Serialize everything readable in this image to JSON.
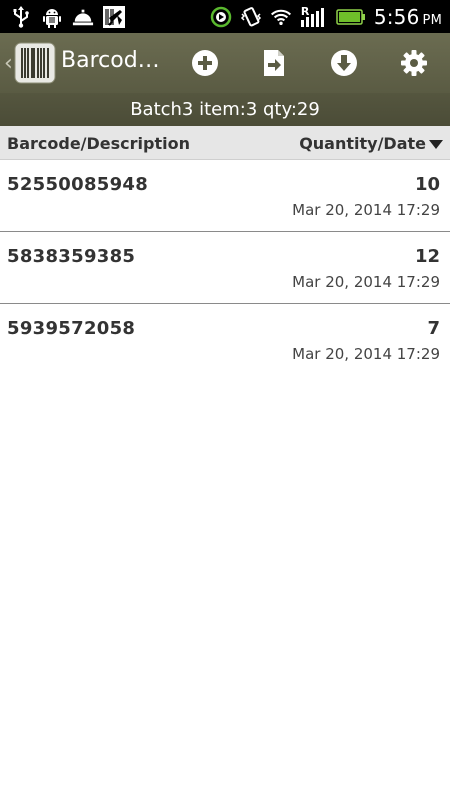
{
  "status_bar": {
    "icons": [
      "usb-icon",
      "android-debug-icon",
      "service-bell-icon",
      "barcode-app-icon",
      "sync-icon",
      "vibrate-icon",
      "wifi-icon",
      "signal-icon",
      "battery-icon"
    ],
    "roaming_letter": "R",
    "time": "5:56",
    "ampm": "PM"
  },
  "action_bar": {
    "title": "Barcod…",
    "buttons": [
      "add-icon",
      "export-icon",
      "download-icon",
      "settings-icon"
    ]
  },
  "batch_info": "Batch3 item:3 qty:29",
  "columns": {
    "left": "Barcode/Description",
    "right": "Quantity/Date"
  },
  "items": [
    {
      "barcode": "52550085948",
      "quantity": "10",
      "date": "Mar 20, 2014 17:29"
    },
    {
      "barcode": "5838359385",
      "quantity": "12",
      "date": "Mar 20, 2014 17:29"
    },
    {
      "barcode": "5939572058",
      "quantity": "7",
      "date": "Mar 20, 2014 17:29"
    }
  ],
  "colors": {
    "action_bar": "#5f6048",
    "batch_bar": "#505139",
    "header_bg": "#e6e6e6",
    "text": "#333333"
  }
}
